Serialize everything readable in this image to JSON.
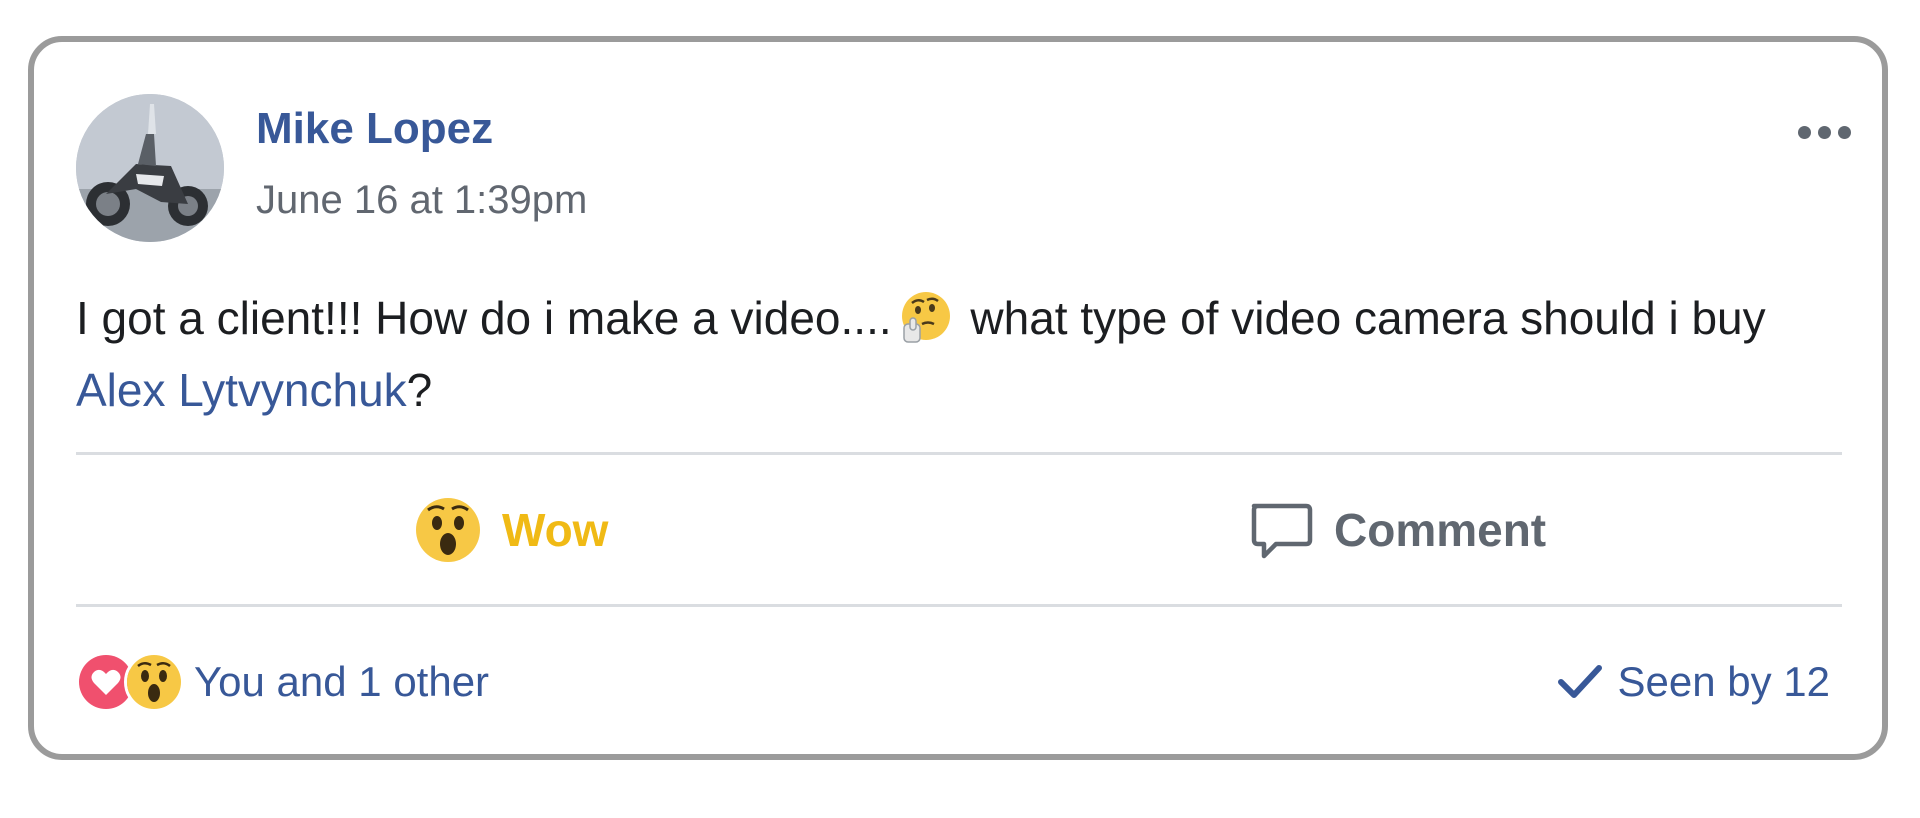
{
  "post": {
    "author": "Mike Lopez",
    "timestamp": "June 16 at 1:39pm",
    "text_part1": "I got a client!!! How do i make a video....",
    "inline_emoji": "thinking-face-emoji",
    "text_part2": " what type of video camera should i buy ",
    "mention": "Alex Lytvynchuk",
    "text_part3": "?",
    "more_options_icon": "more-horizontal-icon"
  },
  "actions": {
    "reaction_label": "Wow",
    "reaction_icon": "wow-emoji-icon",
    "reaction_color": "#f0ba15",
    "comment_label": "Comment",
    "comment_icon": "speech-bubble-icon"
  },
  "footer": {
    "reaction_icons": [
      "love-reaction-icon",
      "wow-reaction-icon"
    ],
    "reactions_summary": "You and 1 other",
    "seen_icon": "checkmark-icon",
    "seen_text": "Seen by 12"
  },
  "colors": {
    "link": "#385898",
    "meta": "#616770",
    "text": "#1c1e21",
    "love": "#f0506e",
    "wow": "#f7c845",
    "divider": "#dadde1",
    "border": "#9b9b9b"
  }
}
